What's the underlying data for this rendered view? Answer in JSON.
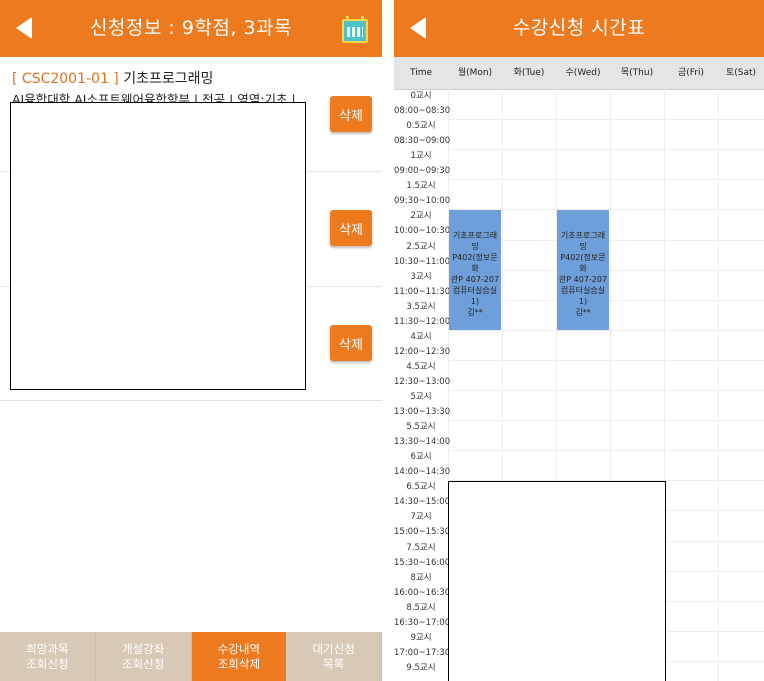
{
  "left": {
    "header": {
      "title": "신청정보 : 9학점,  3과목"
    },
    "course": {
      "code": "[ CSC2001-01 ]",
      "name": "기초프로그래밍",
      "info": "AI융합대학 AI소프트웨어융합학부 | 전공 | 영역:기초 |"
    },
    "delete_label": "삭제",
    "nav": [
      {
        "line1": "희망과목",
        "line2": "조회신청"
      },
      {
        "line1": "개설강좌",
        "line2": "조회신청"
      },
      {
        "line1": "수강내역",
        "line2": "조회삭제"
      },
      {
        "line1": "대기신청",
        "line2": "목록"
      }
    ],
    "active_nav_index": 2
  },
  "right": {
    "header": {
      "title": "수강신청 시간표"
    },
    "columns": [
      "Time",
      "월(Mon)",
      "화(Tue)",
      "수(Wed)",
      "목(Thu)",
      "금(Fri)",
      "토(Sat)"
    ],
    "time_rows": [
      "0교시",
      "08:00~08:30",
      "0.5교시",
      "08:30~09:00",
      "1교시",
      "09:00~09:30",
      "1.5교시",
      "09:30~10:00",
      "2교시",
      "10:00~10:30",
      "2.5교시",
      "10:30~11:00",
      "3교시",
      "11:00~11:30",
      "3.5교시",
      "11:30~12:00",
      "4교시",
      "12:00~12:30",
      "4.5교시",
      "12:30~13:00",
      "5교시",
      "13:00~13:30",
      "5.5교시",
      "13:30~14:00",
      "6교시",
      "14:00~14:30",
      "6.5교시",
      "14:30~15:00",
      "7교시",
      "15:00~15:30",
      "7.5교시",
      "15:30~16:00",
      "8교시",
      "16:00~16:30",
      "8.5교시",
      "16:30~17:00",
      "9교시",
      "17:00~17:30",
      "9.5교시"
    ],
    "classes": [
      {
        "day": "월(Mon)",
        "start_period": "2교시",
        "end_period": "3.5교시",
        "lines": [
          "기초프로그래",
          "밍",
          "P402(정보문화",
          "관P 407-207",
          "컴퓨터실습실",
          "1)",
          "김**"
        ]
      },
      {
        "day": "수(Wed)",
        "start_period": "2교시",
        "end_period": "3.5교시",
        "lines": [
          "기초프로그래",
          "밍",
          "P402(정보문화",
          "관P 407-207",
          "컴퓨터실습실",
          "1)",
          "김**"
        ]
      }
    ]
  },
  "colors": {
    "accent": "#ee7a1f",
    "class_block": "#6f9fd8",
    "nav_inactive": "#d8c9b6"
  }
}
